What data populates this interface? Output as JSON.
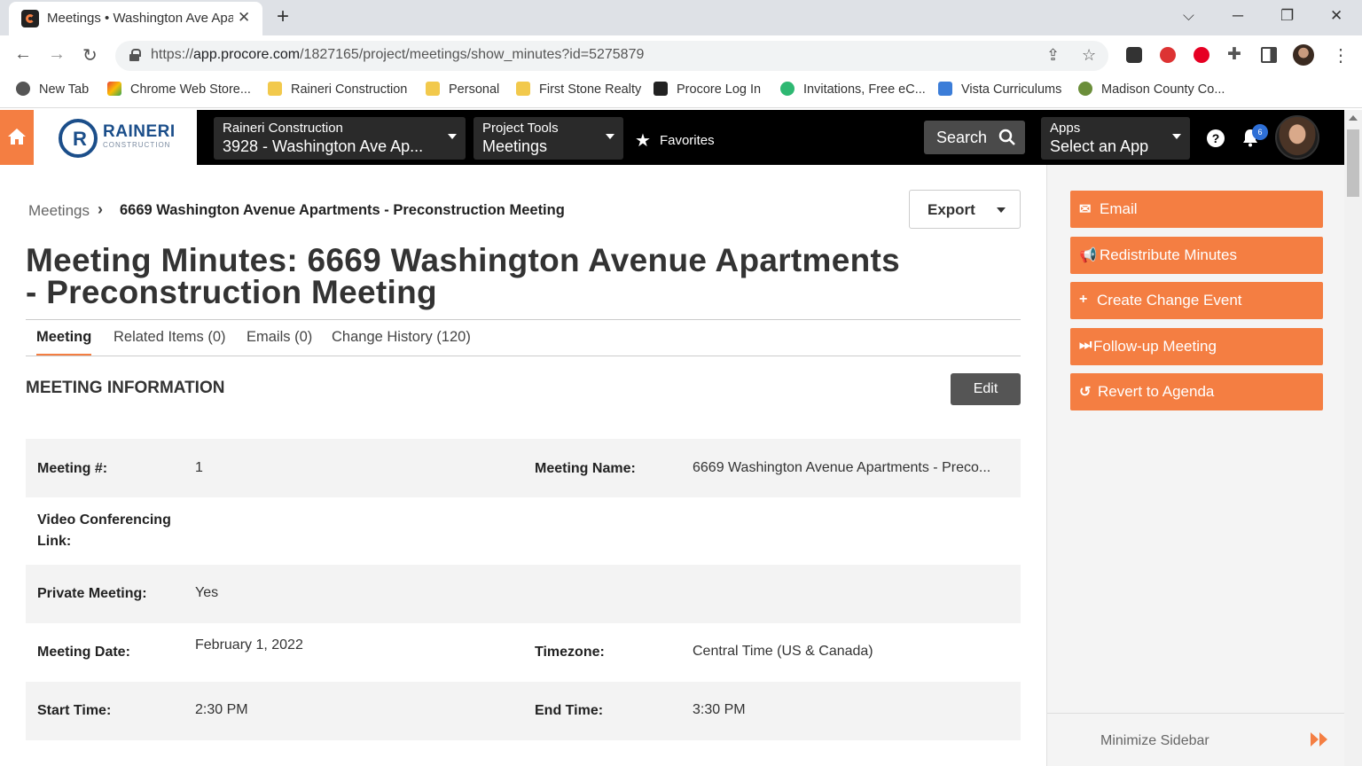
{
  "browser": {
    "tab_title": "Meetings • Washington Ave Apartments",
    "url_prefix": "https://",
    "url_host": "app.procore.com",
    "url_path": "/1827165/project/meetings/show_minutes?id=5275879",
    "bookmarks": [
      {
        "label": "New Tab",
        "icon": "globe-icon",
        "color": "#555555"
      },
      {
        "label": "Chrome Web Store...",
        "icon": "chrome-store-icon",
        "color": "#ea4335"
      },
      {
        "label": "Raineri Construction",
        "icon": "folder-icon",
        "color": "#f2c94c"
      },
      {
        "label": "Personal",
        "icon": "folder-icon",
        "color": "#f2c94c"
      },
      {
        "label": "First Stone Realty",
        "icon": "folder-icon",
        "color": "#f2c94c"
      },
      {
        "label": "Procore Log In",
        "icon": "procore-icon",
        "color": "#222222"
      },
      {
        "label": "Invitations, Free eC...",
        "icon": "evite-icon",
        "color": "#2eb872"
      },
      {
        "label": "Vista Curriculums",
        "icon": "vista-icon",
        "color": "#3b7dd8"
      },
      {
        "label": "Madison County Co...",
        "icon": "county-icon",
        "color": "#6b8e3a"
      }
    ]
  },
  "header": {
    "logo_text": "RAINERI",
    "logo_sub": "CONSTRUCTION",
    "company_label": "Raineri Construction",
    "project_label": "3928 - Washington Ave Ap...",
    "tools_label": "Project Tools",
    "tools_value": "Meetings",
    "favorites": "Favorites",
    "search": "Search",
    "apps_label": "Apps",
    "apps_value": "Select an App",
    "notification_count": "6"
  },
  "page": {
    "breadcrumb_root": "Meetings",
    "breadcrumb_current": "6669 Washington Avenue Apartments - Preconstruction Meeting",
    "export_label": "Export",
    "title": "Meeting Minutes: 6669 Washington Avenue Apartments - Preconstruction Meeting",
    "tabs": [
      "Meeting",
      "Related Items (0)",
      "Emails (0)",
      "Change History (120)"
    ],
    "section_title": "MEETING INFORMATION",
    "edit_label": "Edit"
  },
  "meeting_info": {
    "meeting_number_label": "Meeting #:",
    "meeting_number": "1",
    "meeting_name_label": "Meeting Name:",
    "meeting_name": "6669 Washington Avenue Apartments - Preco...",
    "video_label": "Video Conferencing Link:",
    "private_label": "Private Meeting:",
    "private_value": "Yes",
    "date_label": "Meeting Date:",
    "date_value": "February 1, 2022",
    "timezone_label": "Timezone:",
    "timezone_value": "Central Time (US & Canada)",
    "start_label": "Start Time:",
    "start_value": "2:30 PM",
    "end_label": "End Time:",
    "end_value": "3:30 PM"
  },
  "sidebar": {
    "buttons": [
      {
        "label": "Email",
        "icon": "envelope-icon"
      },
      {
        "label": "Redistribute Minutes",
        "icon": "megaphone-icon"
      },
      {
        "label": "Create Change Event",
        "icon": "plus-icon"
      },
      {
        "label": "Follow-up Meeting",
        "icon": "skip-forward-icon"
      },
      {
        "label": "Revert to Agenda",
        "icon": "undo-icon"
      }
    ],
    "minimize_label": "Minimize Sidebar"
  },
  "colors": {
    "accent": "#f47e42",
    "header_bg": "#000000",
    "logo_blue": "#1b4e8a"
  }
}
